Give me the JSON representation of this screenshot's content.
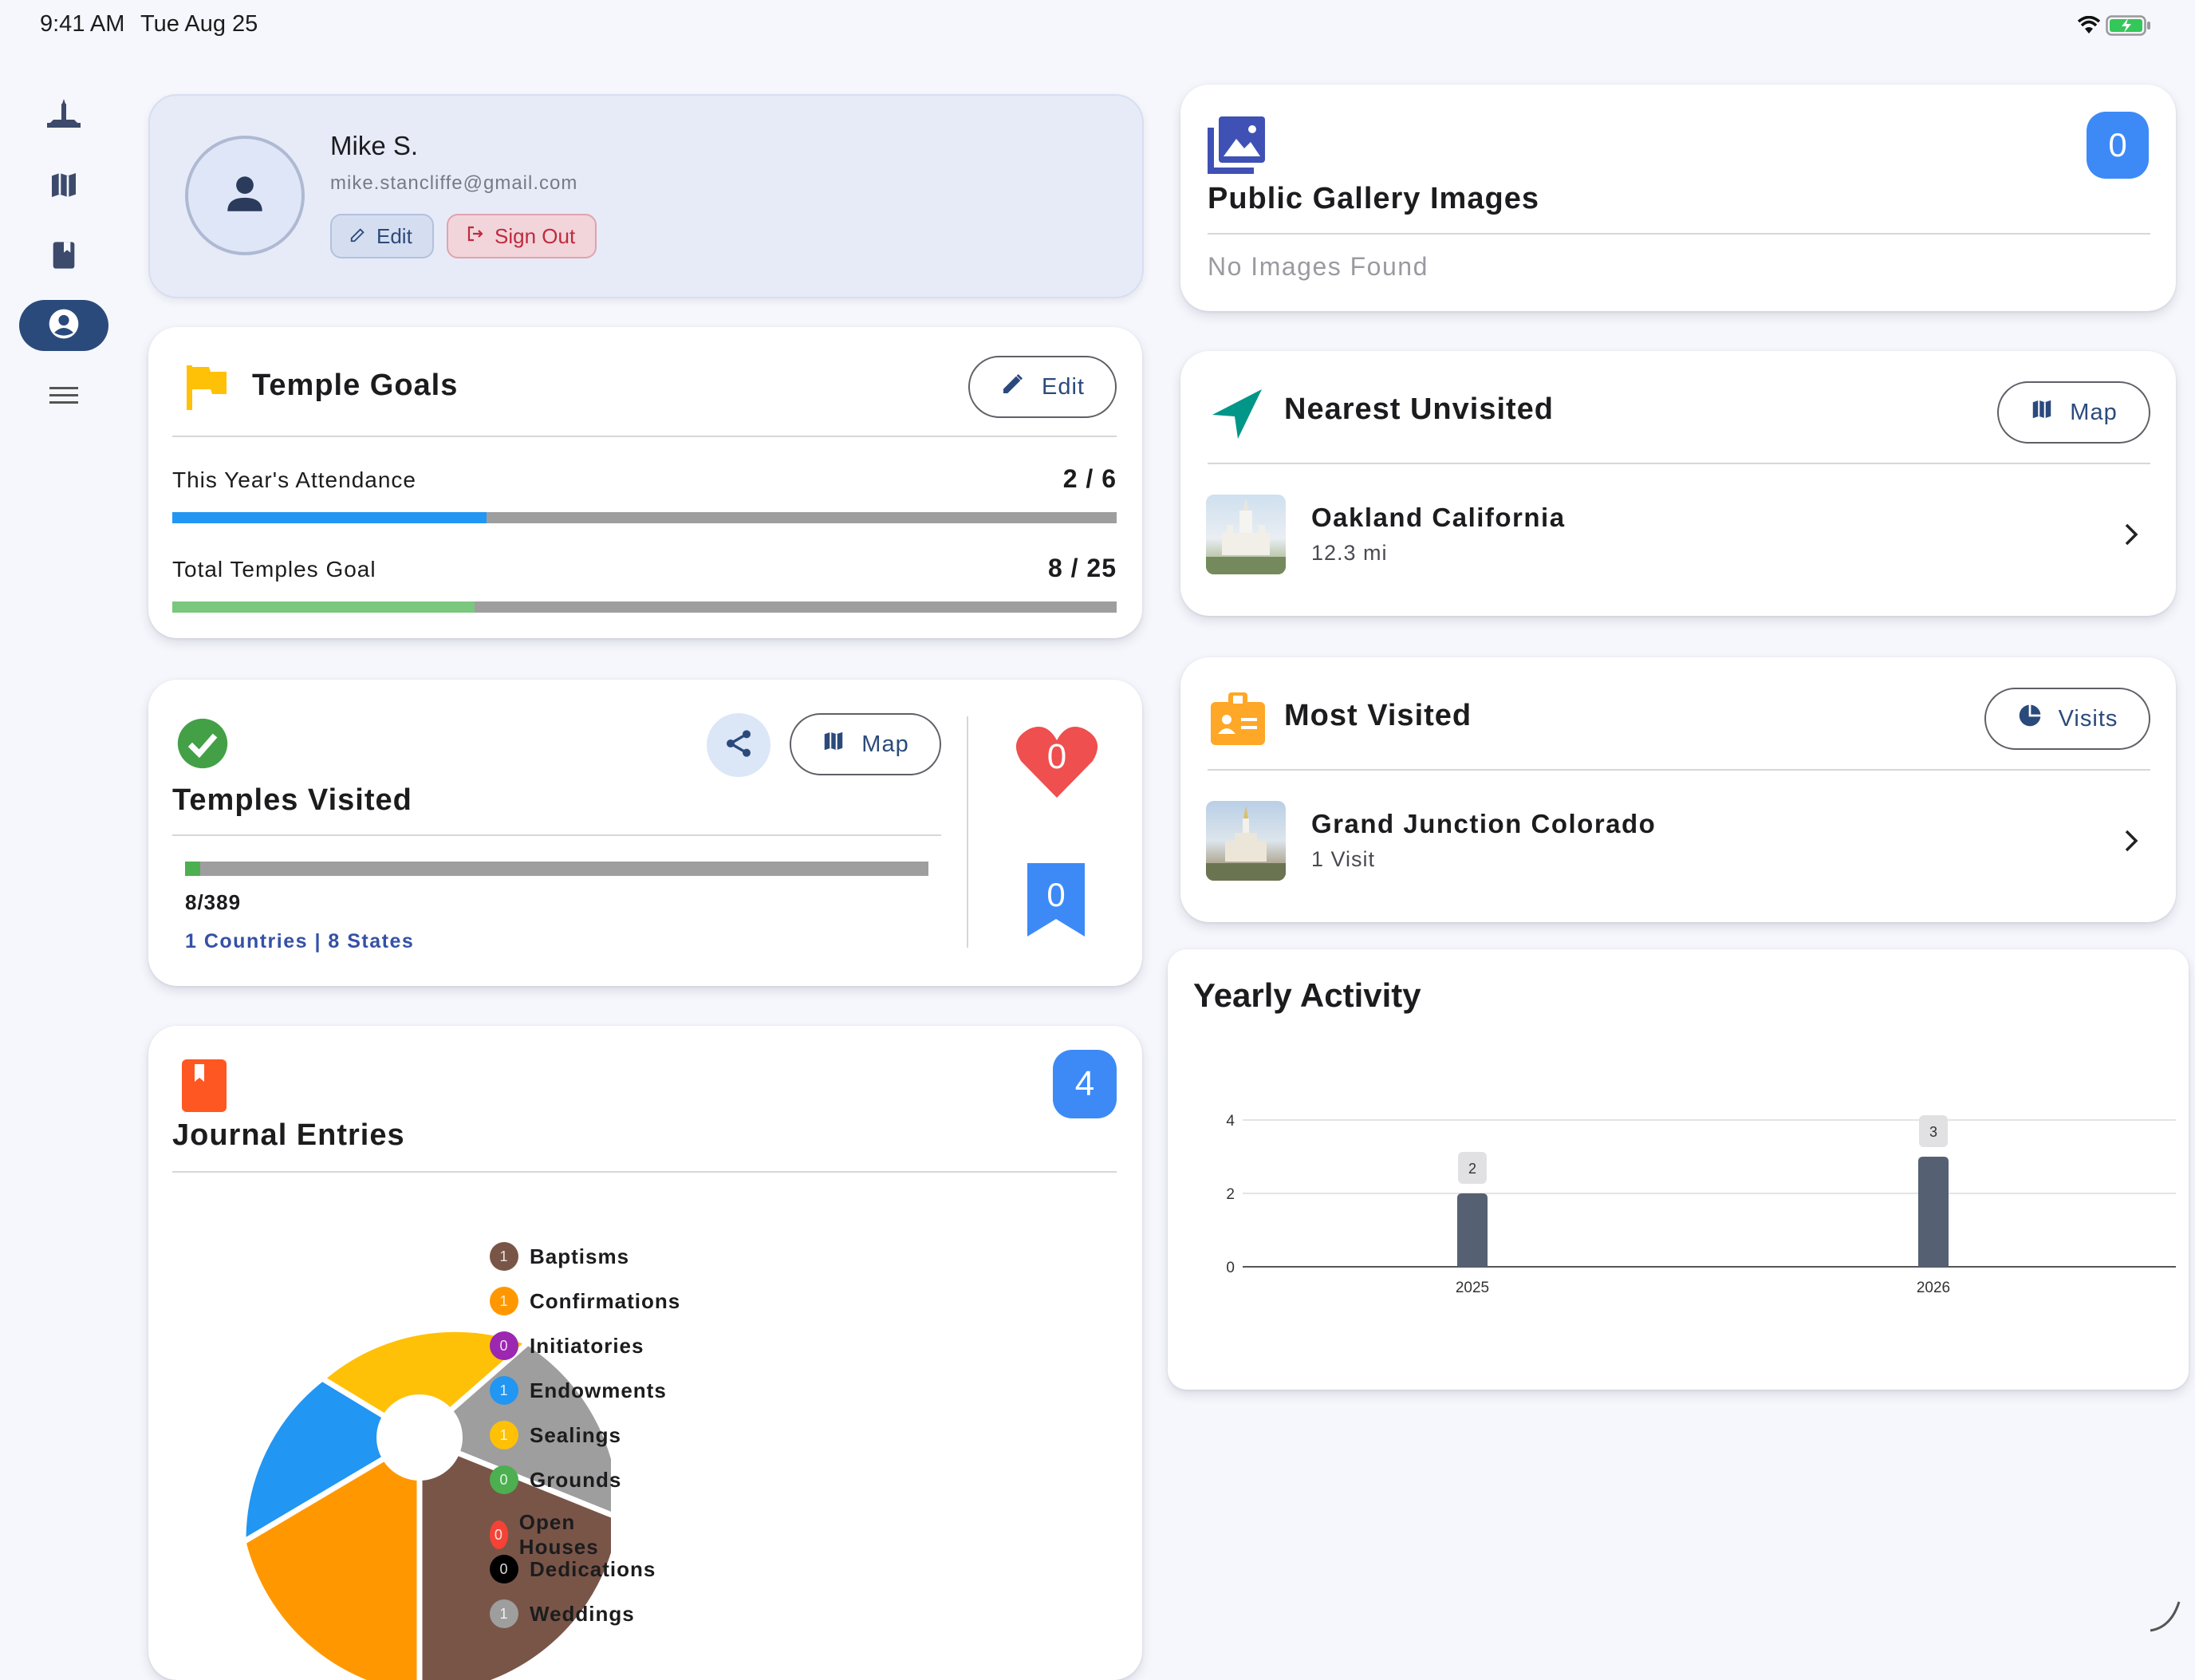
{
  "status_bar": {
    "time": "9:41 AM",
    "date": "Tue Aug 25"
  },
  "nav_rail": {
    "items": [
      "temple-icon",
      "map-icon",
      "book-icon",
      "account-icon",
      "menu-icon"
    ],
    "active_index": 3
  },
  "profile": {
    "name": "Mike S.",
    "email": "mike.stancliffe@gmail.com",
    "edit_label": "Edit",
    "signout_label": "Sign Out"
  },
  "temple_goals": {
    "title": "Temple Goals",
    "edit_label": "Edit",
    "rows": [
      {
        "label": "This Year's Attendance",
        "value_text": "2 / 6",
        "progress": 0.333,
        "color": "#2196f3"
      },
      {
        "label": "Total Temples Goal",
        "value_text": "8 / 25",
        "progress": 0.32,
        "color": "#7ac77d"
      }
    ]
  },
  "temples_visited": {
    "title": "Temples Visited",
    "map_label": "Map",
    "progress_text": "8/389",
    "progress": 0.0206,
    "summary": "1 Countries | 8 States",
    "favorites_count": "0",
    "bookmarks_count": "0"
  },
  "journal": {
    "title": "Journal Entries",
    "count": "4",
    "legend": [
      {
        "label": "Baptisms",
        "count": "1",
        "color": "#795548"
      },
      {
        "label": "Confirmations",
        "count": "1",
        "color": "#ff9800"
      },
      {
        "label": "Initiatories",
        "count": "0",
        "color": "#9c27b0"
      },
      {
        "label": "Endowments",
        "count": "1",
        "color": "#2196f3"
      },
      {
        "label": "Sealings",
        "count": "1",
        "color": "#ffc107"
      },
      {
        "label": "Grounds",
        "count": "0",
        "color": "#4caf50"
      },
      {
        "label": "Open Houses",
        "count": "0",
        "color": "#f44336"
      },
      {
        "label": "Dedications",
        "count": "0",
        "color": "#000000"
      },
      {
        "label": "Weddings",
        "count": "1",
        "color": "#9e9e9e"
      }
    ]
  },
  "gallery": {
    "title": "Public Gallery Images",
    "count": "0",
    "empty_text": "No Images Found"
  },
  "nearest": {
    "title": "Nearest Unvisited",
    "map_label": "Map",
    "item_title": "Oakland California",
    "item_sub": "12.3 mi"
  },
  "most_visited": {
    "title": "Most Visited",
    "visits_label": "Visits",
    "item_title": "Grand Junction Colorado",
    "item_sub": "1 Visit"
  },
  "chart_data": {
    "type": "bar",
    "title": "Yearly Activity",
    "categories": [
      "2025",
      "2026"
    ],
    "values": [
      2,
      3
    ],
    "ylim": [
      0,
      4
    ],
    "yticks": [
      0,
      2,
      4
    ],
    "grid": true,
    "bar_color": "#556073"
  }
}
